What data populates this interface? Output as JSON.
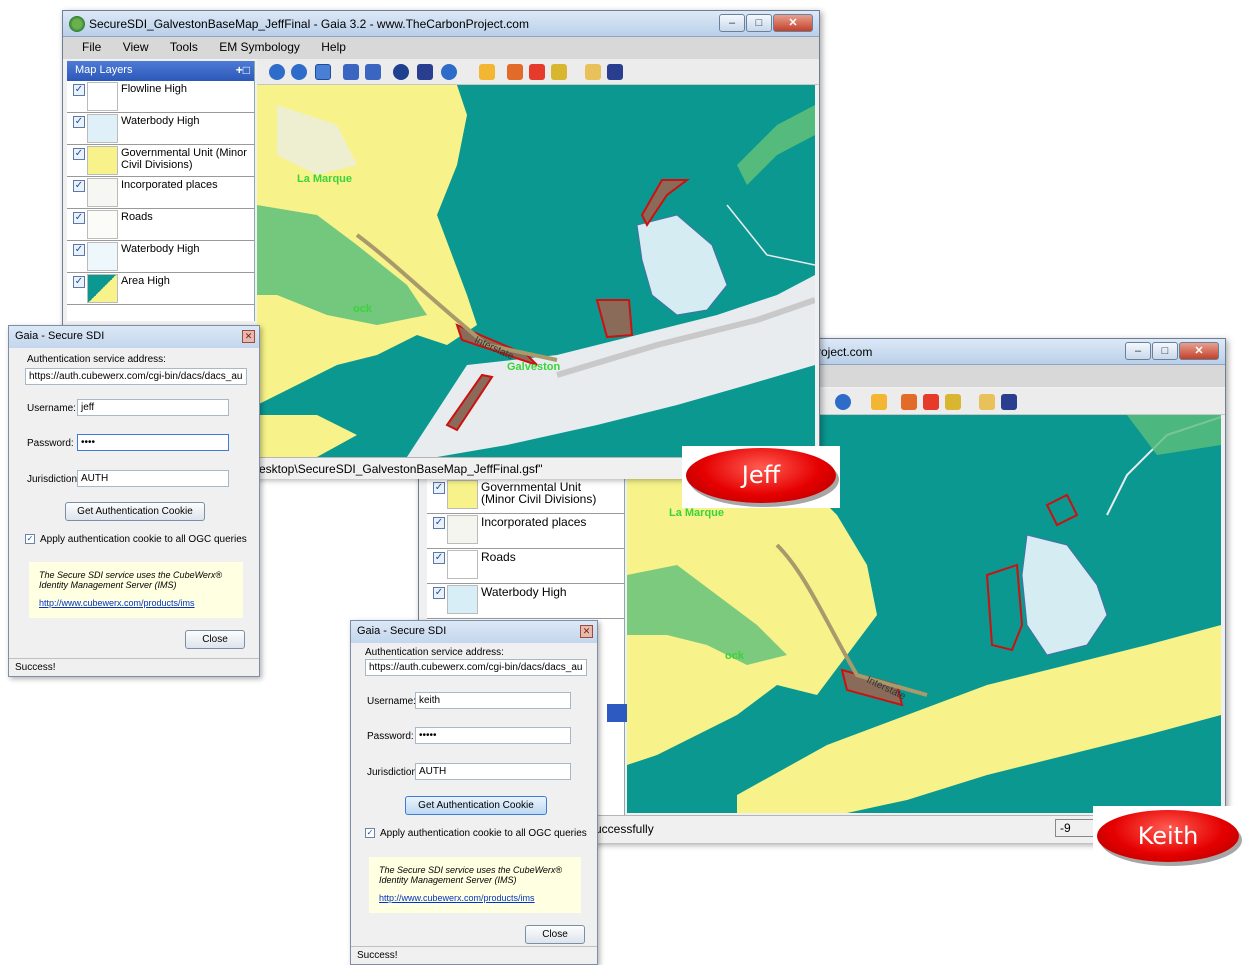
{
  "window1": {
    "title": "SecureSDI_GalvestonBaseMap_JeffFinal - Gaia 3.2 - www.TheCarbonProject.com",
    "menu": [
      "File",
      "View",
      "Tools",
      "EM Symbology",
      "Help"
    ],
    "layers_title": "Map Layers",
    "layers": [
      "Flowline High",
      "Waterbody High",
      "Governmental Unit (Minor Civil Divisions)",
      "Incorporated places",
      "Roads",
      "Waterbody High",
      "Area High"
    ],
    "status_text": "esktop\\SecureSDI_GalvestonBaseMap_JeffFinal.gsf\"",
    "map_labels": [
      "La Marque",
      "Galveston",
      "ock",
      "Interstate"
    ]
  },
  "window2": {
    "title": "roject.com",
    "layers": [
      "Governmental Unit (Minor Civil Divisions)",
      "Incorporated places",
      "Roads",
      "Waterbody High"
    ],
    "status_text": "uccessfully",
    "status_right": "-9",
    "map_labels": [
      "La Marque",
      "ock",
      "Interstate"
    ]
  },
  "dialog_jeff": {
    "title": "Gaia - Secure SDI",
    "auth_label": "Authentication service address:",
    "auth_value": "https://auth.cubewerx.com/cgi-bin/dacs/dacs_au",
    "username_label": "Username:",
    "username_value": "jeff",
    "password_label": "Password:",
    "password_value": "••••",
    "jurisdiction_label": "Jurisdiction:",
    "jurisdiction_value": "AUTH",
    "cookie_button": "Get Authentication Cookie",
    "apply_label": "Apply authentication cookie to all OGC queries",
    "note": "The Secure SDI service uses the CubeWerx® Identity Management Server (IMS)",
    "link": "http://www.cubewerx.com/products/ims",
    "close_button": "Close",
    "status": "Success!"
  },
  "dialog_keith": {
    "title": "Gaia - Secure SDI",
    "auth_label": "Authentication service address:",
    "auth_value": "https://auth.cubewerx.com/cgi-bin/dacs/dacs_au",
    "username_label": "Username:",
    "username_value": "keith",
    "password_label": "Password:",
    "password_value": "•••••",
    "jurisdiction_label": "Jurisdiction:",
    "jurisdiction_value": "AUTH",
    "cookie_button": "Get Authentication Cookie",
    "apply_label": "Apply authentication cookie to all OGC queries",
    "note": "The Secure SDI service uses the CubeWerx® Identity Management Server (IMS)",
    "link": "http://www.cubewerx.com/products/ims",
    "close_button": "Close",
    "status": "Success!"
  },
  "badges": {
    "jeff": "Jeff",
    "keith": "Keith"
  },
  "colors": {
    "water": "#0a9890",
    "land": "#f7f38a",
    "urban": "#e9ecef",
    "vegetation": "#5dbf7a",
    "polygon_outline": "#cc1111"
  }
}
